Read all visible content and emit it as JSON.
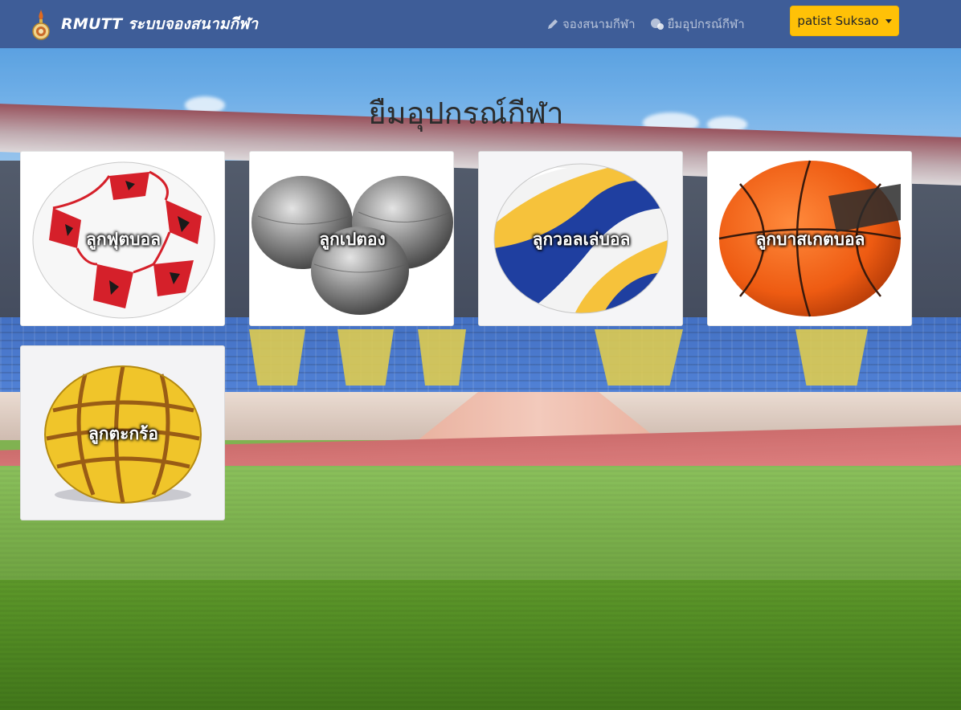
{
  "navbar": {
    "brand": "RMUTT ระบบจองสนามกีฬา",
    "links": [
      {
        "label": "จองสนามกีฬา",
        "icon": "pencil-icon"
      },
      {
        "label": "ยืมอุปกรณ์กีฬา",
        "icon": "equipment-icon"
      }
    ],
    "user": "patist Suksao"
  },
  "main": {
    "title": "ยืมอุปกรณ์กีฬา",
    "cards": [
      {
        "label": "ลูกฟุตบอล",
        "icon": "football-image"
      },
      {
        "label": "ลูกเปตอง",
        "icon": "petanque-image"
      },
      {
        "label": "ลูกวอลเล่บอล",
        "icon": "volleyball-image"
      },
      {
        "label": "ลูกบาสเกตบอล",
        "icon": "basketball-image"
      },
      {
        "label": "ลูกตะกร้อ",
        "icon": "takraw-image"
      }
    ]
  },
  "colors": {
    "navbar": "#3e5d98",
    "user_button": "#ffc107"
  }
}
